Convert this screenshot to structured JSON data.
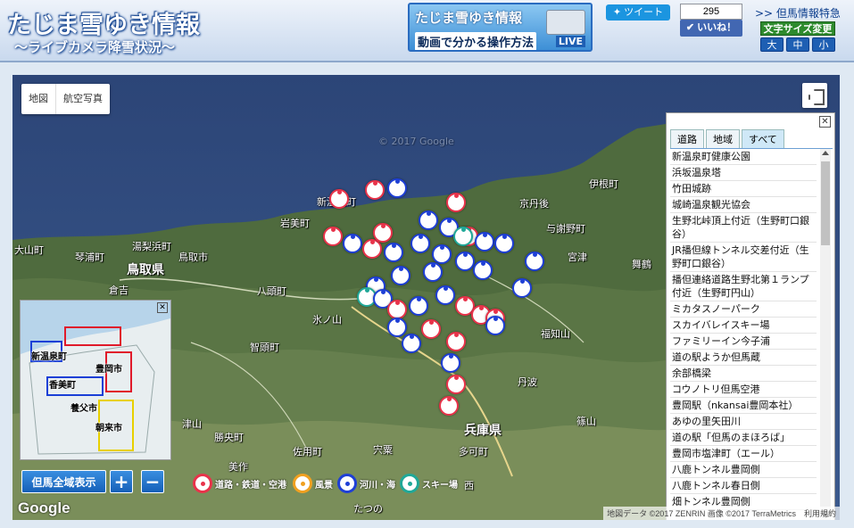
{
  "header": {
    "title": "たじま雪ゆき情報",
    "subtitle": "～ライブカメラ降雪状況～",
    "banner_title": "たじま雪ゆき情報",
    "banner_sub": "動画で分かる操作方法",
    "banner_live": "LIVE",
    "tweet": "ツイート",
    "like_count": "295",
    "like": "いいね！",
    "special_link": ">> 但馬情報特急",
    "font_size_label": "文字サイズ変更",
    "font_sizes": [
      "大",
      "中",
      "小"
    ]
  },
  "map": {
    "type_buttons": [
      "地図",
      "航空写真"
    ],
    "places": [
      "新温泉町",
      "岩美町",
      "鳥取市",
      "鳥取県",
      "倉吉",
      "八頭町",
      "智頭町",
      "津山",
      "勝央町",
      "美作",
      "佐用町",
      "宍粟",
      "多可町",
      "兵庫県",
      "丹波",
      "福知山",
      "篠山",
      "舞鶴",
      "宮津",
      "与謝野町",
      "京丹後",
      "伊根町",
      "氷ノ山",
      "大山町",
      "琴浦町",
      "湯梨浜町",
      "たつの",
      "西"
    ],
    "watermark": "© 2017 Google",
    "google": "Google",
    "attribution": "地図データ ©2017 ZENRIN 画像 ©2017 TerraMetrics　利用規約"
  },
  "panel": {
    "tabs": [
      "道路",
      "地域",
      "すべて"
    ],
    "active_tab": "すべて",
    "items": [
      "新温泉町健康公園",
      "浜坂温泉塔",
      "竹田城跡",
      "城崎温泉観光協会",
      "生野北峠頂上付近（生野町口銀谷）",
      "JR播但線トンネル交差付近（生野町口銀谷）",
      "播但連絡道路生野北第１ランプ付近（生野町円山）",
      "ミカタスノーパーク",
      "スカイバレイスキー場",
      "ファミリーイン今子浦",
      "道の駅ようか但馬蔵",
      "余部橋梁",
      "コウノトリ但馬空港",
      "豊岡駅（nkansai豊岡本社）",
      "あゆの里矢田川",
      "道の駅「但馬のまほろば」",
      "豊岡市塩津町（エール）",
      "八鹿トンネル豊岡側",
      "八鹿トンネル春日側",
      "畑トンネル豊岡側"
    ]
  },
  "minimap": {
    "labels": [
      "新温泉町",
      "豊岡市",
      "香美町",
      "養父市",
      "朝来市"
    ]
  },
  "controls": {
    "whole": "但馬全域表示",
    "zoom_in": "+",
    "zoom_out": "−"
  },
  "legend": {
    "items": [
      "道路・鉄道・空港",
      "風景",
      "河川・海",
      "スキー場"
    ],
    "colors": [
      "#e8334a",
      "#f0a020",
      "#1e3fd6",
      "#20a898"
    ]
  }
}
